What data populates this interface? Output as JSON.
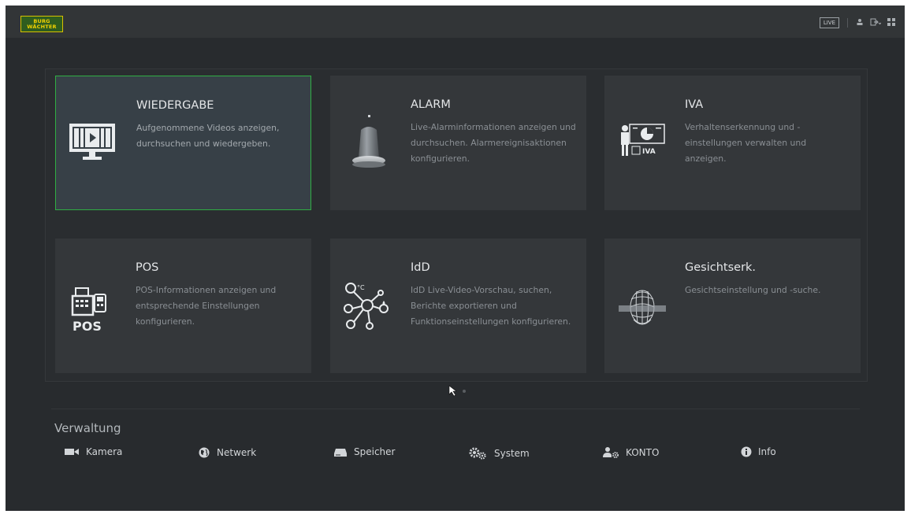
{
  "topbar": {
    "logo_line1": "BURG",
    "logo_line2": "WÄCHTER",
    "live_label": "LIVE",
    "icons": [
      "user-icon",
      "logout-icon",
      "grid-menu-icon"
    ]
  },
  "cards": [
    {
      "title": "WIEDERGABE",
      "desc": "Aufgenommene Videos anzeigen, durchsuchen und wiedergeben.",
      "icon": "playback-monitor-icon",
      "active": true
    },
    {
      "title": "ALARM",
      "desc": "Live-Alarminformationen anzeigen und durchsuchen. Alarmereignisaktionen konfigurieren.",
      "icon": "alarm-siren-icon",
      "active": false
    },
    {
      "title": "IVA",
      "desc": "Verhaltenserkennung und -einstellungen verwalten und anzeigen.",
      "icon": "iva-analytics-icon",
      "icon_label": "IVA",
      "active": false
    },
    {
      "title": "POS",
      "desc": "POS-Informationen anzeigen und entsprechende Einstellungen konfigurieren.",
      "icon": "pos-register-icon",
      "icon_label": "POS",
      "active": false
    },
    {
      "title": "IdD",
      "desc": "IdD Live-Video-Vorschau, suchen, Berichte exportieren und Funktionseinstellungen konfigurieren.",
      "icon": "iot-sensor-network-icon",
      "active": false
    },
    {
      "title": "Gesichtserk.",
      "desc": "Gesichtseinstellung und -suche.",
      "icon": "face-recognition-icon",
      "active": false
    }
  ],
  "management": {
    "heading": "Verwaltung",
    "items": [
      {
        "label": "Kamera",
        "icon": "camera-icon"
      },
      {
        "label": "Netwerk",
        "icon": "network-globe-icon"
      },
      {
        "label": "Speicher",
        "icon": "storage-drive-icon"
      },
      {
        "label": "System",
        "icon": "system-gears-icon"
      },
      {
        "label": "KONTO",
        "icon": "account-users-icon"
      },
      {
        "label": "Info",
        "icon": "info-icon"
      }
    ]
  },
  "accent_color": "#2fae43"
}
